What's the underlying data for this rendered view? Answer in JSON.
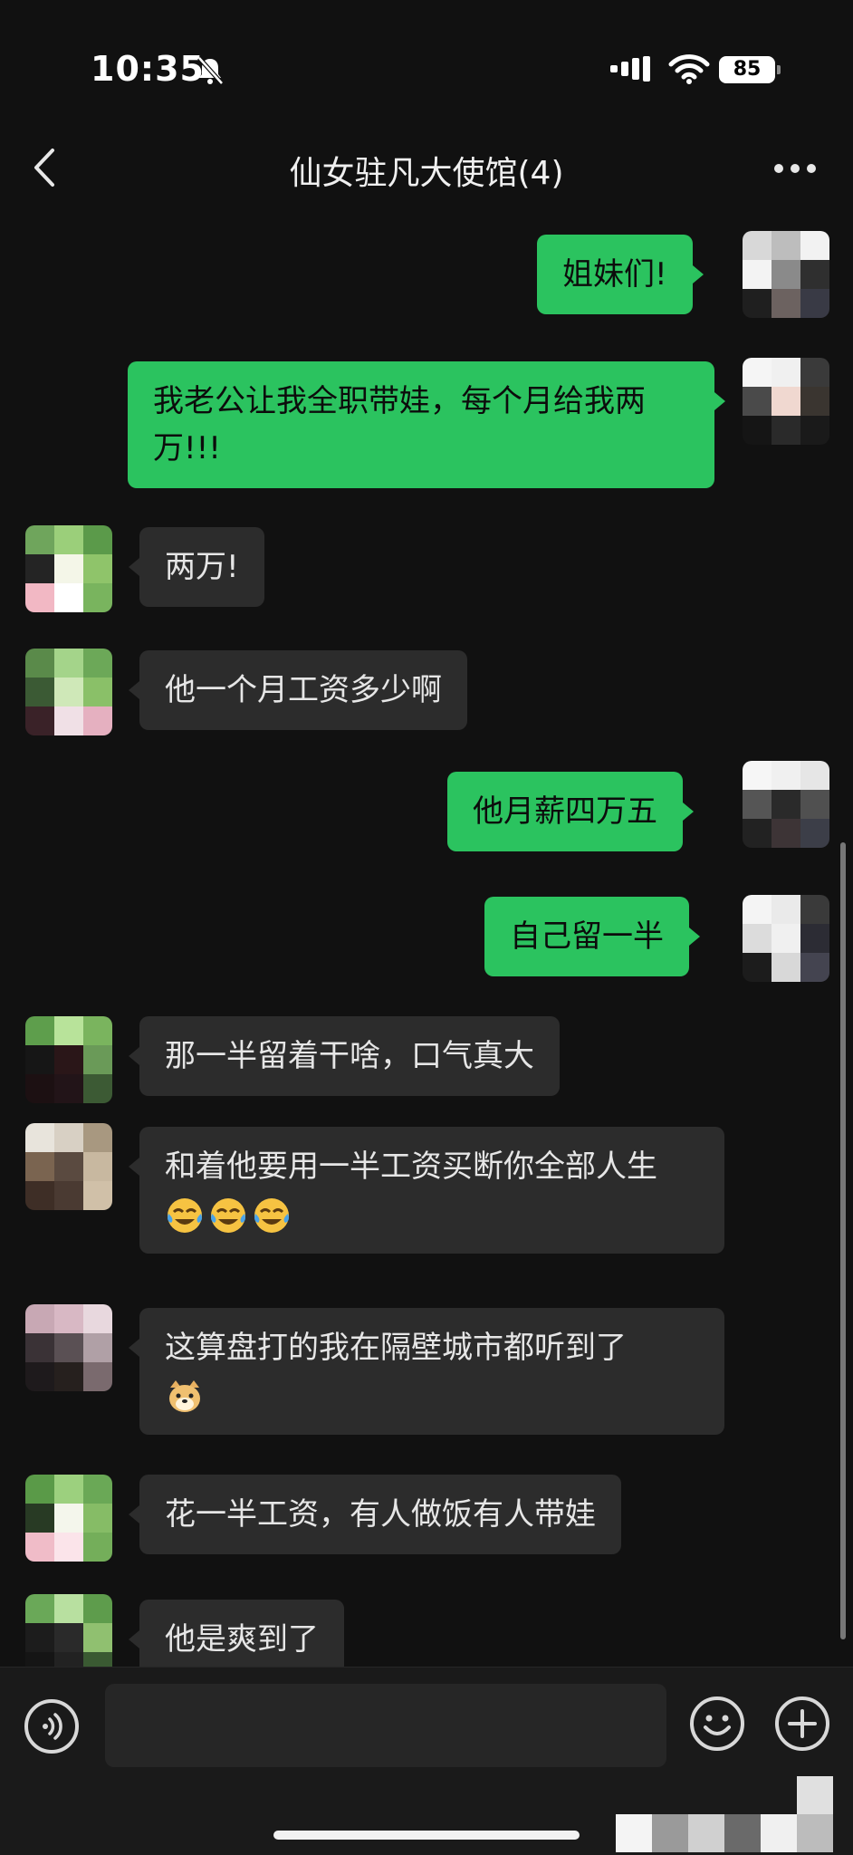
{
  "status_bar": {
    "time": "10:35",
    "battery": "85"
  },
  "header": {
    "title": "仙女驻凡大使馆(4)"
  },
  "messages": [
    {
      "side": "me",
      "text": "姐妹们!"
    },
    {
      "side": "me",
      "text": "我老公让我全职带娃，每个月给我两万!!!"
    },
    {
      "side": "them",
      "text": "两万!"
    },
    {
      "side": "them",
      "text": "他一个月工资多少啊"
    },
    {
      "side": "me",
      "text": "他月薪四万五"
    },
    {
      "side": "me",
      "text": "自己留一半"
    },
    {
      "side": "them",
      "text": "那一半留着干啥，口气真大"
    },
    {
      "side": "them",
      "text": "和着他要用一半工资买断你全部人生",
      "emoji": "crying-laughing"
    },
    {
      "side": "them",
      "text": "这算盘打的我在隔壁城市都听到了",
      "emoji": "doge"
    },
    {
      "side": "them",
      "text": "花一半工资，有人做饭有人带娃"
    },
    {
      "side": "them",
      "text": "他是爽到了"
    }
  ],
  "input": {
    "value": "",
    "placeholder": ""
  },
  "icons": {
    "back": "chevron-left-icon",
    "more": "more-dots-icon",
    "voice": "voice-icon",
    "emoji": "emoji-face-icon",
    "plus": "plus-icon"
  },
  "colors": {
    "my_bubble": "#2bc35f",
    "their_bubble": "#2c2c2c",
    "background": "#111111"
  }
}
